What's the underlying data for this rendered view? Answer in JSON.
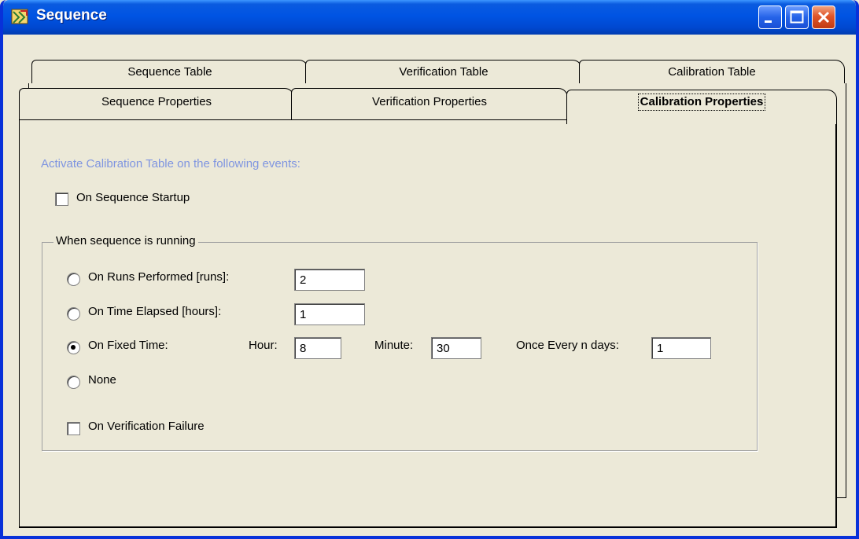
{
  "window": {
    "title": "Sequence",
    "icon": "app-icon"
  },
  "titlebar_buttons": {
    "minimize": "minimize-icon",
    "maximize": "maximize-icon",
    "close": "close-icon"
  },
  "tabs": {
    "back": [
      "Sequence Table",
      "Verification Table",
      "Calibration Table"
    ],
    "front": [
      "Sequence Properties",
      "Verification Properties",
      "Calibration Properties"
    ],
    "active": "Calibration Properties"
  },
  "panel": {
    "instruction": "Activate Calibration Table on the following events:",
    "on_startup": {
      "label": "On Sequence Startup",
      "checked": false
    },
    "group": {
      "title": "When sequence is running",
      "runs": {
        "label": "On Runs Performed [runs]:",
        "value": "2",
        "selected": false
      },
      "time": {
        "label": "On Time Elapsed [hours]:",
        "value": "1",
        "selected": false
      },
      "fixed": {
        "label": "On Fixed Time:",
        "selected": true,
        "hour_label": "Hour:",
        "hour": "8",
        "minute_label": "Minute:",
        "minute": "30",
        "days_label": "Once Every n days:",
        "days": "1"
      },
      "none": {
        "label": "None",
        "selected": false
      },
      "verification_failure": {
        "label": "On Verification Failure",
        "checked": false
      }
    }
  }
}
